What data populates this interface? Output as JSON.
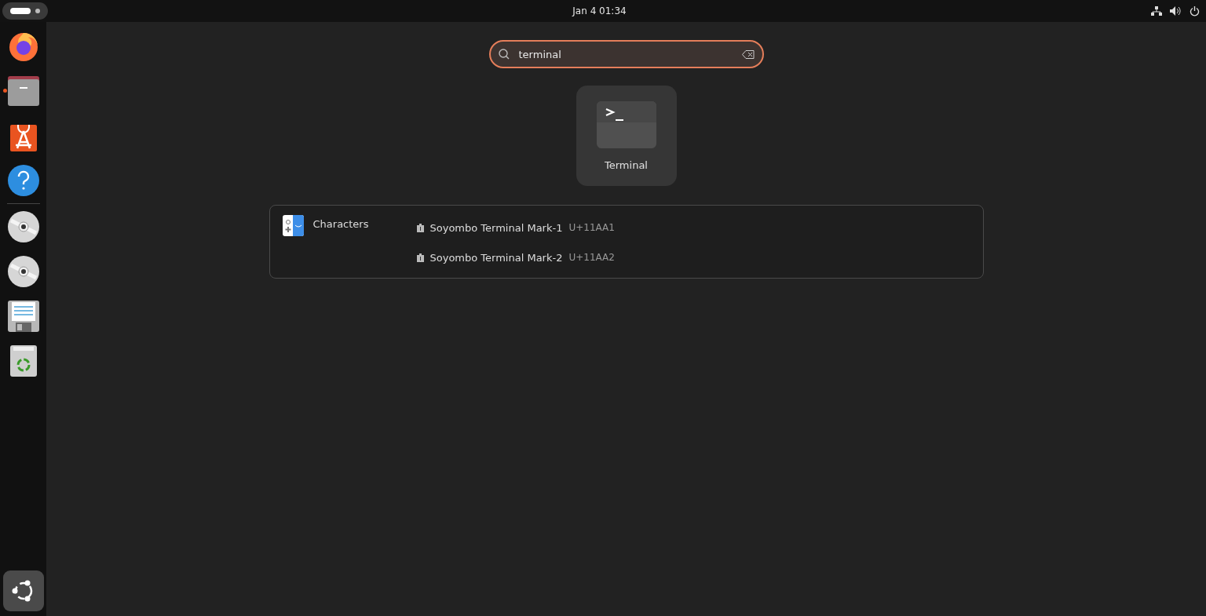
{
  "top_bar": {
    "clock": "Jan 4  01:34"
  },
  "dock": {
    "items": [
      {
        "kind": "browser",
        "running": false
      },
      {
        "kind": "files",
        "running": true
      },
      {
        "kind": "store",
        "running": false
      },
      {
        "kind": "help",
        "running": false
      },
      {
        "kind": "separator"
      },
      {
        "kind": "disc",
        "running": false
      },
      {
        "kind": "disc",
        "running": false
      },
      {
        "kind": "floppy",
        "running": false
      },
      {
        "kind": "trash",
        "running": false
      }
    ]
  },
  "search": {
    "value": "terminal"
  },
  "apps": [
    {
      "label": "Terminal",
      "selected": true
    }
  ],
  "providers": [
    {
      "name": "Characters",
      "results": [
        {
          "title": "Soyombo Terminal Mark-1",
          "code": "U+11AA1"
        },
        {
          "title": "Soyombo Terminal Mark-2",
          "code": "U+11AA2"
        }
      ]
    }
  ]
}
